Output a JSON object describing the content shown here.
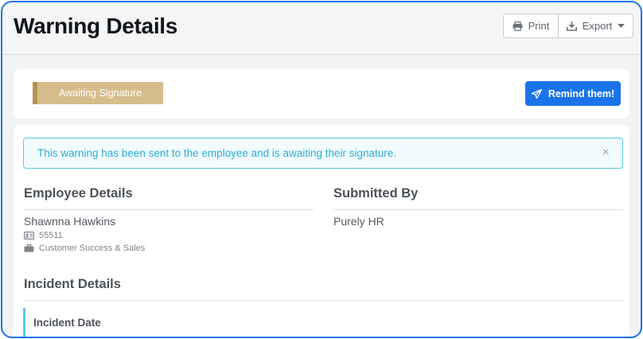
{
  "header": {
    "title": "Warning Details",
    "print_label": "Print",
    "export_label": "Export"
  },
  "status": {
    "badge": "Awaiting Signature",
    "remind_label": "Remind them!",
    "colors": {
      "badge_bg": "#d6bd8c",
      "badge_border": "#b8934f",
      "primary": "#1a73e8"
    }
  },
  "alert": {
    "message": "This warning has been sent to the employee and is awaiting their signature.",
    "close": "×"
  },
  "employee": {
    "heading": "Employee Details",
    "name": "Shawnna Hawkins",
    "id": "55511",
    "department": "Customer Success & Sales"
  },
  "submitted": {
    "heading": "Submitted By",
    "name": "Purely HR"
  },
  "incident": {
    "heading": "Incident Details",
    "date_label": "Incident Date"
  }
}
